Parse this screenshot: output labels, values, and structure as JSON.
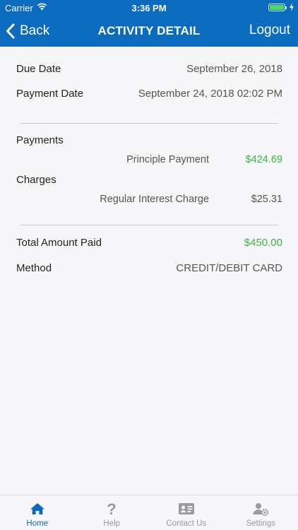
{
  "status_bar": {
    "carrier": "Carrier",
    "time": "3:36 PM"
  },
  "nav": {
    "back_label": "Back",
    "title": "ACTIVITY DETAIL",
    "logout_label": "Logout"
  },
  "details": {
    "due_date_label": "Due Date",
    "due_date_value": "September 26, 2018",
    "payment_date_label": "Payment Date",
    "payment_date_value": "September 24, 2018 02:02 PM"
  },
  "payments": {
    "section_label": "Payments",
    "items": [
      {
        "label": "Principle Payment",
        "amount": "$424.69"
      }
    ]
  },
  "charges": {
    "section_label": "Charges",
    "items": [
      {
        "label": "Regular Interest Charge",
        "amount": "$25.31"
      }
    ]
  },
  "summary": {
    "total_label": "Total Amount Paid",
    "total_value": "$450.00",
    "method_label": "Method",
    "method_value": "CREDIT/DEBIT CARD"
  },
  "tab_bar": {
    "tabs": [
      {
        "label": "Home",
        "icon": "home-icon",
        "active": true
      },
      {
        "label": "Help",
        "icon": "help-icon",
        "active": false
      },
      {
        "label": "Contact Us",
        "icon": "contact-card-icon",
        "active": false
      },
      {
        "label": "Settings",
        "icon": "user-settings-icon",
        "active": false
      }
    ]
  },
  "colors": {
    "brand_blue": "#0b6cbf",
    "positive_green": "#3bb54a",
    "battery_green": "#4cd964"
  }
}
